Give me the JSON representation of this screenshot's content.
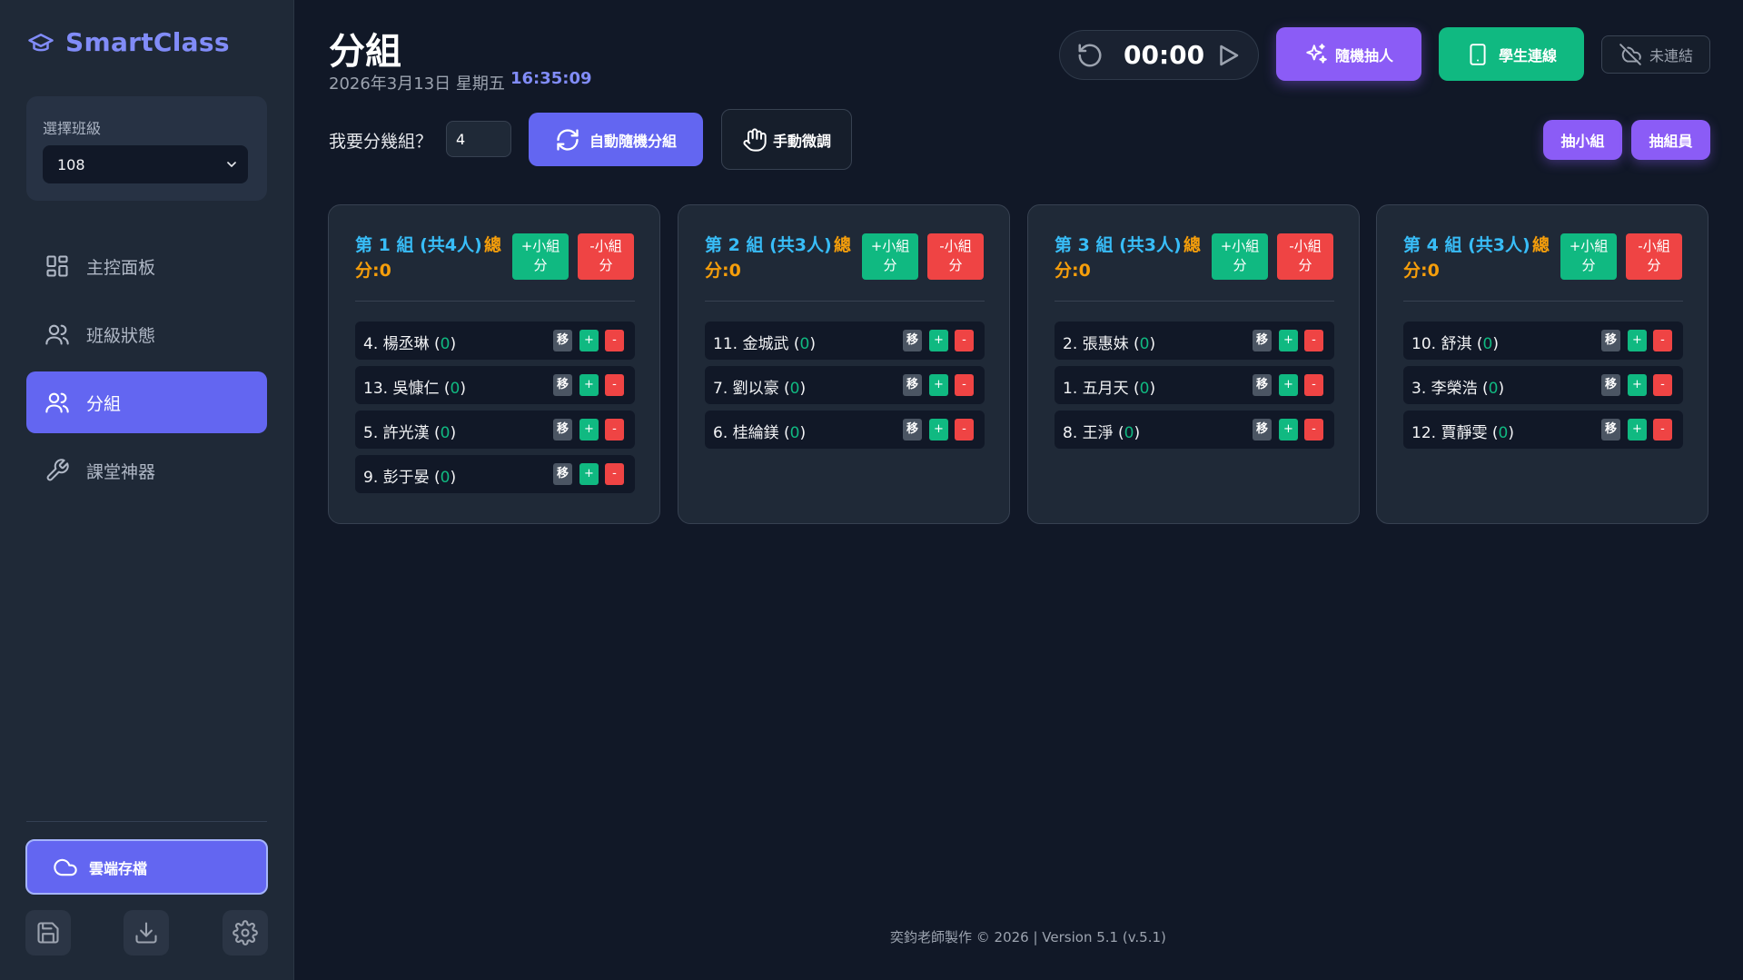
{
  "sidebar": {
    "brand": "SmartClass",
    "class_label": "選擇班級",
    "class_value": "108",
    "nav": [
      {
        "label": "主控面板",
        "icon": "dashboard-icon",
        "active": false
      },
      {
        "label": "班級狀態",
        "icon": "users-icon",
        "active": false
      },
      {
        "label": "分組",
        "icon": "users-icon",
        "active": true
      },
      {
        "label": "課堂神器",
        "icon": "wrench-icon",
        "active": false
      }
    ],
    "cloud_label": "雲端存檔",
    "utility_icons": [
      "save-icon",
      "download-icon",
      "settings-icon"
    ]
  },
  "header": {
    "title": "分組",
    "date": "2026年3月13日 星期五",
    "time": "16:35:09",
    "timer": "00:00",
    "random_pick": "隨機抽人",
    "student_connect": "學生連線",
    "connection_status": "未連結"
  },
  "toolbar": {
    "ask_label": "我要分幾組？",
    "group_count": "4",
    "auto_group": "自動隨機分組",
    "manual_adjust": "手動微調",
    "pick_group": "抽小組",
    "pick_member": "抽組員"
  },
  "group_labels": {
    "score_total_1": "總",
    "score_total_2": "分:",
    "plus_group": [
      "+小組",
      "分"
    ],
    "minus_group": [
      "-小組",
      "分"
    ],
    "move": "移",
    "add": "+",
    "sub": "-"
  },
  "groups": [
    {
      "title": "第 1 組 (共4人)",
      "score": "0",
      "members": [
        {
          "name": "4. 楊丞琳",
          "points": "0"
        },
        {
          "name": "13. 吳慷仁",
          "points": "0"
        },
        {
          "name": "5. 許光漢",
          "points": "0"
        },
        {
          "name": "9. 彭于晏",
          "points": "0"
        }
      ]
    },
    {
      "title": "第 2 組 (共3人)",
      "score": "0",
      "members": [
        {
          "name": "11. 金城武",
          "points": "0"
        },
        {
          "name": "7. 劉以豪",
          "points": "0"
        },
        {
          "name": "6. 桂綸鎂",
          "points": "0"
        }
      ]
    },
    {
      "title": "第 3 組 (共3人)",
      "score": "0",
      "members": [
        {
          "name": "2. 張惠妹",
          "points": "0"
        },
        {
          "name": "1. 五月天",
          "points": "0"
        },
        {
          "name": "8. 王淨",
          "points": "0"
        }
      ]
    },
    {
      "title": "第 4 組 (共3人)",
      "score": "0",
      "members": [
        {
          "name": "10. 舒淇",
          "points": "0"
        },
        {
          "name": "3. 李榮浩",
          "points": "0"
        },
        {
          "name": "12. 賈靜雯",
          "points": "0"
        }
      ]
    }
  ],
  "footer": "奕鈞老師製作 © 2026 | Version 5.1 (v.5.1)",
  "colors": {
    "accent": "#6366f1",
    "purple": "#8b5cf6",
    "green": "#10b981",
    "red": "#ef4444",
    "group_title": "#38bdf8",
    "score": "#f59e0b"
  }
}
